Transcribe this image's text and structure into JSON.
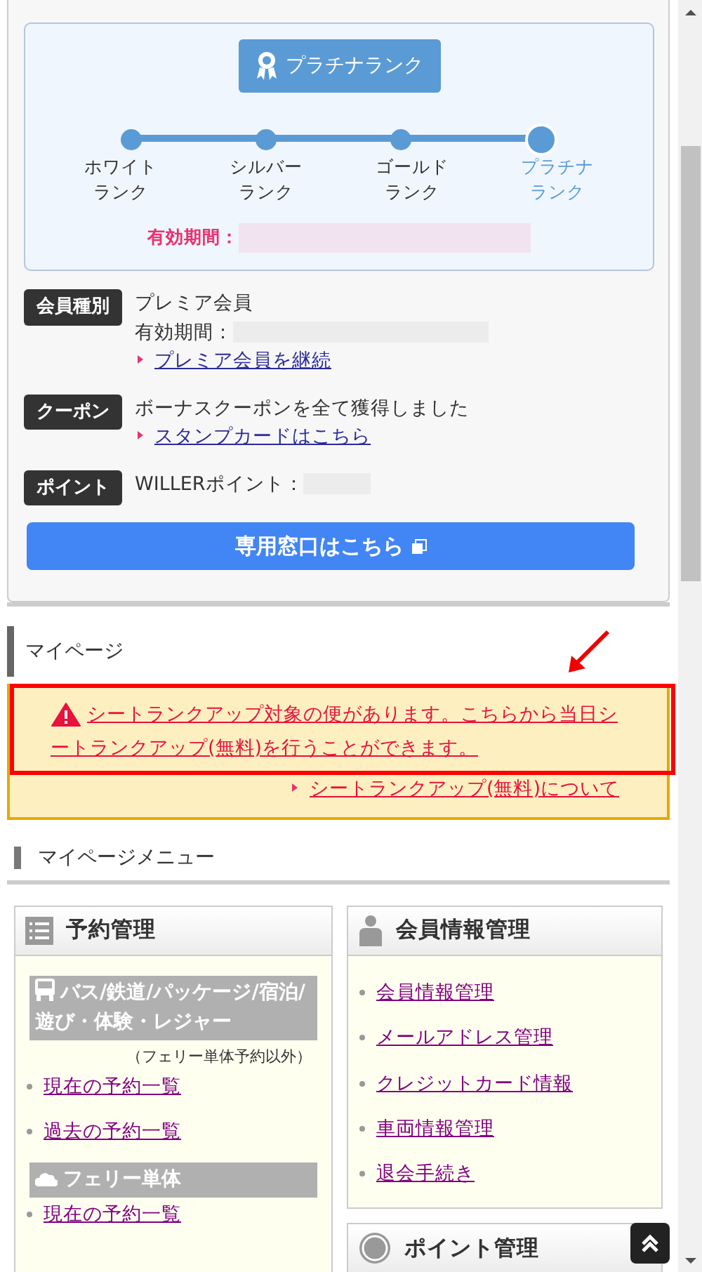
{
  "rank_box": {
    "badge": "プラチナランク",
    "steps": [
      {
        "line1": "ホワイト",
        "line2": "ランク",
        "selected": false
      },
      {
        "line1": "シルバー",
        "line2": "ランク",
        "selected": false
      },
      {
        "line1": "ゴールド",
        "line2": "ランク",
        "selected": false
      },
      {
        "line1": "プラチナ",
        "line2": "ランク",
        "selected": true
      }
    ],
    "validity_label": "有効期間："
  },
  "member_rows": [
    {
      "tag": "会員種別",
      "lines": [
        {
          "text": "プレミア会員",
          "redacted": false
        },
        {
          "text": "有効期間：",
          "redacted": true
        }
      ],
      "link": "プレミア会員を継続"
    },
    {
      "tag": "クーポン",
      "lines": [
        {
          "text": "ボーナスクーポンを全て獲得しました",
          "redacted": false
        }
      ],
      "link": "スタンプカードはこちら"
    },
    {
      "tag": "ポイント",
      "lines": [
        {
          "text": "WILLERポイント：",
          "redacted": true
        }
      ]
    }
  ],
  "window_button": "専用窓口はこちら",
  "mypage": {
    "heading": "マイページ",
    "alert": "シートランクアップ対象の便があります。こちらから当日シートランクアップ(無料)を行うことができます。",
    "about_link": "シートランクアップ(無料)について"
  },
  "menu": {
    "heading": "マイページメニュー",
    "reservations": {
      "title": "予約管理",
      "groups": [
        {
          "kind": "bus",
          "title": "バス/鉄道/パッケージ/宿泊/遊び・体験・レジャー",
          "note": "（フェリー単体予約以外）",
          "links": [
            "現在の予約一覧",
            "過去の予約一覧"
          ]
        },
        {
          "kind": "ferry",
          "title": "フェリー単体",
          "links": [
            "現在の予約一覧"
          ]
        }
      ]
    },
    "member_info": {
      "title": "会員情報管理",
      "links": [
        "会員情報管理",
        "メールアドレス管理",
        "クレジットカード情報",
        "車両情報管理",
        "退会手続き"
      ]
    },
    "points": {
      "title": "ポイント管理"
    }
  }
}
